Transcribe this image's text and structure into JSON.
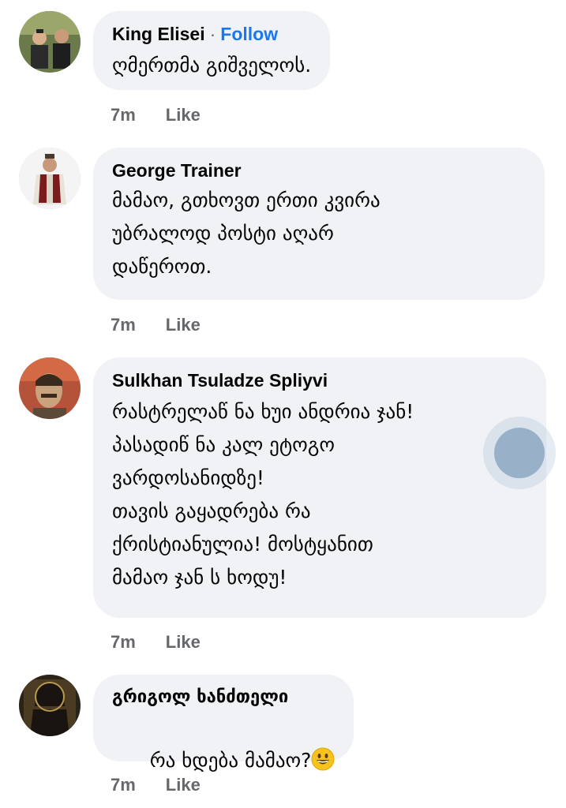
{
  "comments": [
    {
      "author": "King Elisei",
      "follow_separator": "·",
      "follow_label": "Follow",
      "text": "ღმერთმა გიშველოს.",
      "time": "7m",
      "like_label": "Like"
    },
    {
      "author": "George Trainer",
      "text": "მამაო, გთხოვთ ერთი კვირა\nუბრალოდ პოსტი აღარ\nდაწეროთ.",
      "time": "7m",
      "like_label": "Like"
    },
    {
      "author": "Sulkhan Tsuladze Spliyvi",
      "text": "რასტრელაწ ნა ხუი ანდრია ჯან!\nპასადიწ ნა კალ ეტოგო\nვარდოსანიდზე!\nთავის გაყადრება რა\nქრისტიანულია! მოსტყანით\nმამაო ჯან ს ხოდუ!",
      "time": "7m",
      "like_label": "Like"
    },
    {
      "author": "გრიგოლ ხანძთელი",
      "text": "რა ხდება მამაო?",
      "emoji": "grinning-face-emoji",
      "time": "7m",
      "like_label": "Like"
    }
  ],
  "colors": {
    "bubble": "#f0f2f5",
    "follow": "#1877f2",
    "meta": "#65676b",
    "text": "#050505"
  }
}
